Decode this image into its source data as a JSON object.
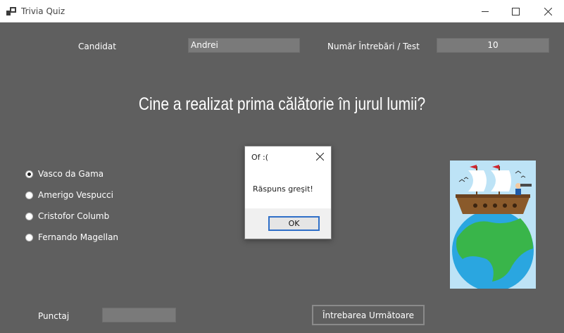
{
  "window": {
    "title": "Trivia Quiz",
    "minimize_icon": "minimize-icon",
    "maximize_icon": "maximize-icon",
    "close_icon": "close-icon"
  },
  "header": {
    "candidate_label": "Candidat",
    "candidate_value": "Andrei",
    "questions_label": "Număr Întrebări / Test",
    "questions_value": "10"
  },
  "question": {
    "text": "Cine a realizat prima călătorie în jurul lumii?"
  },
  "options": [
    {
      "label": "Vasco da Gama",
      "checked": true
    },
    {
      "label": "Amerigo Vespucci",
      "checked": false
    },
    {
      "label": "Cristofor Columb",
      "checked": false
    },
    {
      "label": "Fernando Magellan",
      "checked": false
    }
  ],
  "footer": {
    "score_label": "Punctaj",
    "score_value": "",
    "next_button": "Întrebarea Următoare"
  },
  "dialog": {
    "title": "Of :(",
    "message": "Răspuns greşit!",
    "ok_label": "OK"
  },
  "image": {
    "icon": "ship-on-globe-illustration"
  },
  "colors": {
    "background": "#5f5f5f",
    "field": "#7a7a7a",
    "dialog_accent": "#2f6fc8"
  }
}
